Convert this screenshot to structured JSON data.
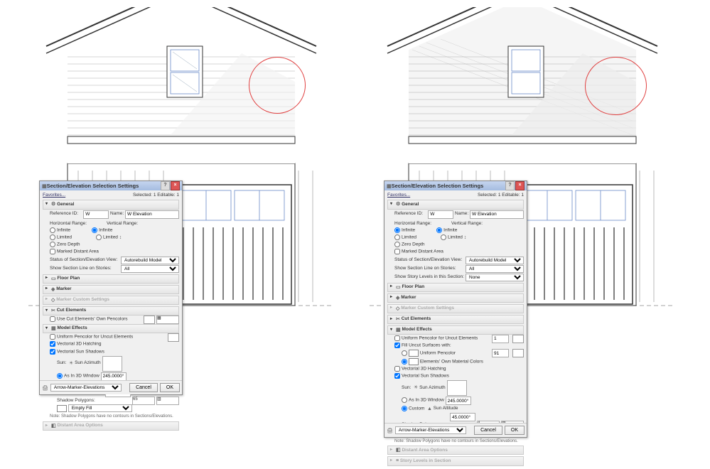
{
  "dialogTitle": "Section/Elevation Selection Settings",
  "favorites": "Favorites...",
  "selectedInfo": "Selected: 1 Editable: 1",
  "sec": {
    "general": "General",
    "floorPlan": "Floor Plan",
    "marker": "Marker",
    "markerCustom": "Marker Custom Settings",
    "cutElements": "Cut Elements",
    "modelEffects": "Model Effects",
    "distantArea": "Distant Area Options",
    "storyLevels": "Story Levels in Section"
  },
  "general": {
    "refIdLbl": "Reference ID:",
    "refId": "W",
    "nameLbl": "Name:",
    "name": "W Elevation",
    "hRangeLbl": "Horizontal Range:",
    "vRangeLbl": "Vertical Range:",
    "infinite": "Infinite",
    "limited": "Limited",
    "zeroDepth": "Zero Depth",
    "markedDistant": "Marked Distant Area",
    "statusLbl": "Status of Section/Elevation View:",
    "statusVal": "Autorebuild Model",
    "showLineLbl": "Show Section Line on Stories:",
    "showLineVal": "All",
    "showStoryLbl": "Show Story Levels in this Section:",
    "showStoryVal": "None"
  },
  "cut": {
    "ownPens": "Use Cut Elements' Own Pencolors",
    "uniformUncut": "Uniform Pencolor for Uncut Elements",
    "fillUncut": "Fill Uncut Surfaces with:",
    "uniformPen": "Uniform Pencolor",
    "ownMat": "Elements' Own Material Colors",
    "vHatch": "Vectorial 3D Hatching",
    "vSun": "Vectorial Sun Shadows",
    "sunLbl": "Sun:",
    "asIn3D": "As In 3D Window",
    "custom": "Custom",
    "azLbl": "Sun Azimuth",
    "azVal": "245.0000°",
    "altLbl": "Sun Altitude",
    "altVal": "45.0000°",
    "shadowPoly": "Shadow Polygons:",
    "emptyLbl": "Empty Fill",
    "note": "Note: Shadow Polygons have no contours in Sections/Elevations."
  },
  "footer": {
    "arrowMarker": "Arrow-Marker-Elevations",
    "cancel": "Cancel",
    "ok": "OK"
  }
}
